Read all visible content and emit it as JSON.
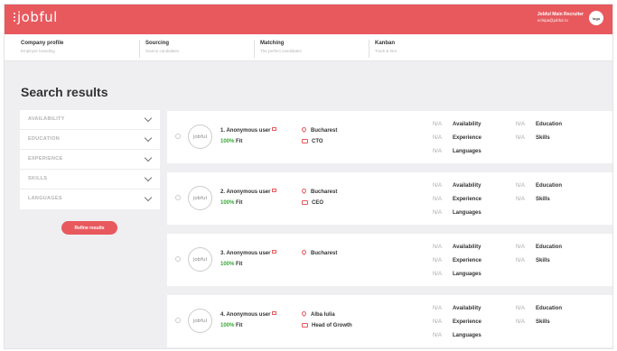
{
  "app": {
    "logo_text": "jobful"
  },
  "user": {
    "name": "Jobful Main Recruiter",
    "email": "echipa@jobful.ro",
    "avatar_text": "logo"
  },
  "nav": [
    {
      "title": "Company profile",
      "subtitle": "Employer branding"
    },
    {
      "title": "Sourcing",
      "subtitle": "Source candidates"
    },
    {
      "title": "Matching",
      "subtitle": "The perfect candidates"
    },
    {
      "title": "Kanban",
      "subtitle": "Track & hire"
    }
  ],
  "page_title": "Search results",
  "filters": [
    "AVAILABILITY",
    "EDUCATION",
    "EXPERIENCE",
    "SKILLS",
    "LANGUAGES"
  ],
  "refine_label": "Refine results",
  "results": [
    {
      "name": "1. Anonymous user",
      "fit_pct": "100%",
      "fit_label": "Fit",
      "location": "Bucharest",
      "role": "CTO",
      "logo_text": "jobful"
    },
    {
      "name": "2. Anonymous user",
      "fit_pct": "100%",
      "fit_label": "Fit",
      "location": "Bucharest",
      "role": "CEO",
      "logo_text": "jobful"
    },
    {
      "name": "3. Anonymous user",
      "fit_pct": "100%",
      "fit_label": "Fit",
      "location": "Bucharest",
      "role": "",
      "logo_text": "jobful"
    },
    {
      "name": "4. Anonymous user",
      "fit_pct": "100%",
      "fit_label": "Fit",
      "location": "Alba Iulia",
      "role": "Head of Growth",
      "logo_text": "jobful"
    }
  ],
  "attributes": {
    "na": "N/A",
    "col1": [
      "Availability",
      "Experience",
      "Languages"
    ],
    "col2": [
      "Education",
      "Skills"
    ]
  },
  "colors": {
    "brand": "#e8595e",
    "fit": "#3aa83a",
    "background": "#efeff1"
  }
}
